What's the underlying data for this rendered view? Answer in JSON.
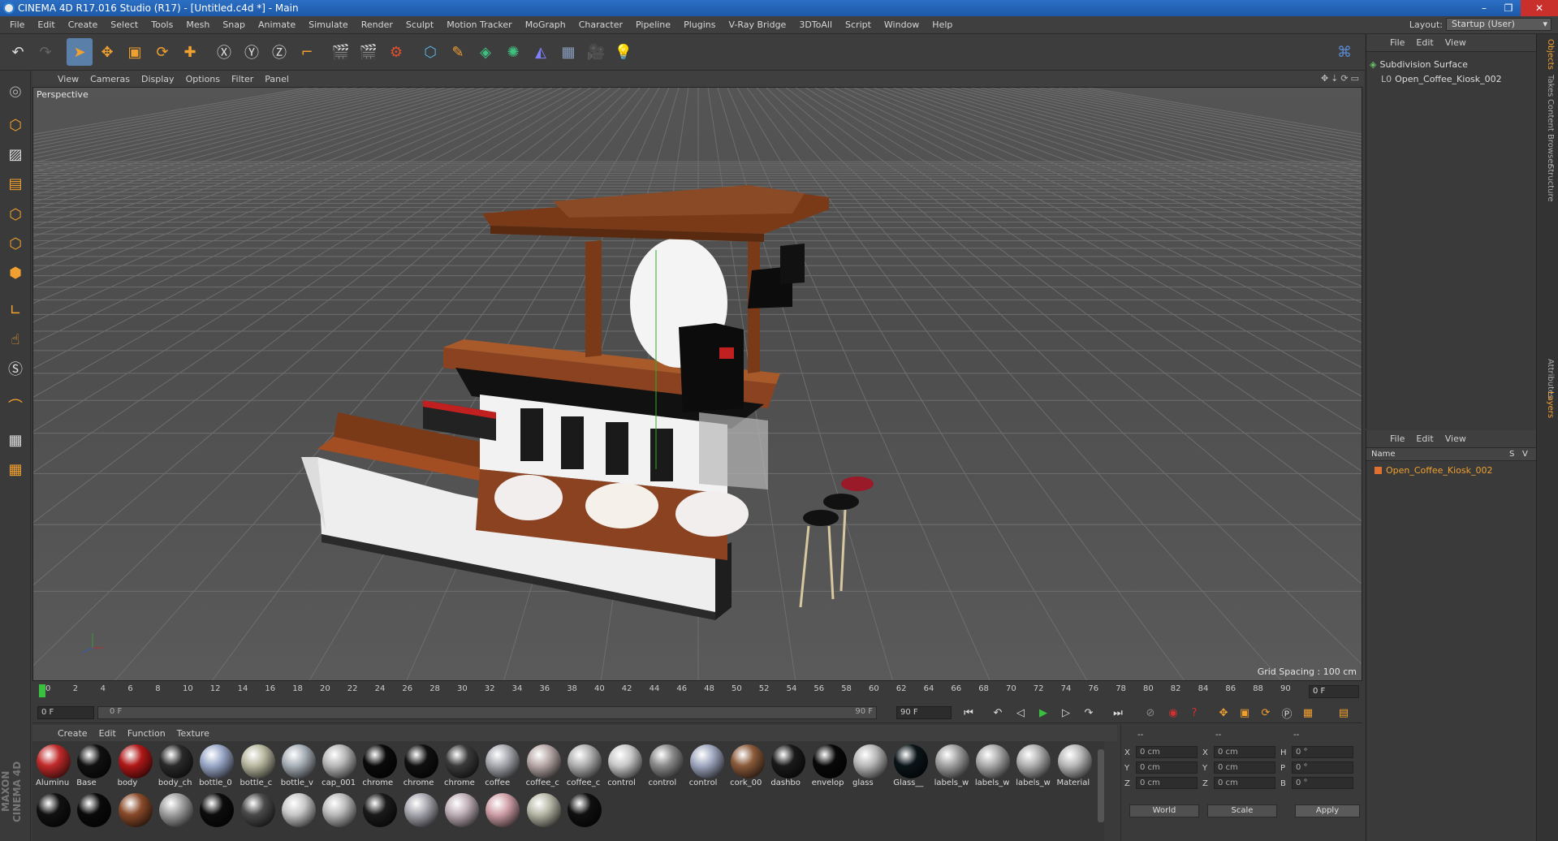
{
  "window": {
    "title": "CINEMA 4D R17.016 Studio (R17) - [Untitled.c4d *] - Main",
    "buttons": [
      "–",
      "❐",
      "✕"
    ]
  },
  "menu": [
    "File",
    "Edit",
    "Create",
    "Select",
    "Tools",
    "Mesh",
    "Snap",
    "Animate",
    "Simulate",
    "Render",
    "Sculpt",
    "Motion Tracker",
    "MoGraph",
    "Character",
    "Pipeline",
    "Plugins",
    "V-Ray Bridge",
    "3DToAll",
    "Script",
    "Window",
    "Help"
  ],
  "layout": {
    "label": "Layout:",
    "value": "Startup (User)"
  },
  "viewport": {
    "menu": [
      "View",
      "Cameras",
      "Display",
      "Options",
      "Filter",
      "Panel"
    ],
    "label": "Perspective",
    "grid_spacing": "Grid Spacing : 100 cm",
    "axis_y": "Y",
    "axis_x": "X"
  },
  "timeline": {
    "ticks": [
      "0",
      "2",
      "4",
      "6",
      "8",
      "10",
      "12",
      "14",
      "16",
      "18",
      "20",
      "22",
      "24",
      "26",
      "28",
      "30",
      "32",
      "34",
      "36",
      "38",
      "40",
      "42",
      "44",
      "46",
      "48",
      "50",
      "52",
      "54",
      "56",
      "58",
      "60",
      "62",
      "64",
      "66",
      "68",
      "70",
      "72",
      "74",
      "76",
      "78",
      "80",
      "82",
      "84",
      "86",
      "88",
      "90"
    ],
    "current": "0 F"
  },
  "playbar": {
    "start": "0 F",
    "slider_start": "0 F",
    "slider_end": "90 F",
    "end": "90 F"
  },
  "material_menu": [
    "Create",
    "Edit",
    "Function",
    "Texture"
  ],
  "materials": [
    {
      "name": "Aluminu",
      "color": "#c02a2a"
    },
    {
      "name": "Base",
      "color": "#111111"
    },
    {
      "name": "body",
      "color": "#b01818"
    },
    {
      "name": "body_ch",
      "color": "#2a2a2a"
    },
    {
      "name": "bottle_0",
      "color": "#9aa8c8"
    },
    {
      "name": "bottle_c",
      "color": "#b8b8a0"
    },
    {
      "name": "bottle_v",
      "color": "#a8b0b8"
    },
    {
      "name": "cap_001",
      "color": "#b8b8b8"
    },
    {
      "name": "chrome",
      "color": "#0a0a0a"
    },
    {
      "name": "chrome",
      "color": "#101010"
    },
    {
      "name": "chrome",
      "color": "#3a3a3a"
    },
    {
      "name": "coffee",
      "color": "#a8aab0"
    },
    {
      "name": "coffee_c",
      "color": "#b8a8a8"
    },
    {
      "name": "coffee_c",
      "color": "#b0b0b0"
    },
    {
      "name": "control",
      "color": "#c8c8c8"
    },
    {
      "name": "control",
      "color": "#8a8a8a"
    },
    {
      "name": "control",
      "color": "#a0a8c0"
    },
    {
      "name": "cork_00",
      "color": "#8a5a3a"
    },
    {
      "name": "dashbo",
      "color": "#1a1a1a"
    },
    {
      "name": "envelop",
      "color": "#080808"
    },
    {
      "name": "glass",
      "color": "#b8b8b8"
    },
    {
      "name": "Glass__",
      "color": "#0a1418"
    },
    {
      "name": "labels_w",
      "color": "#a0a0a0"
    },
    {
      "name": "labels_w",
      "color": "#aaaaaa"
    },
    {
      "name": "labels_w",
      "color": "#b0b0b0"
    },
    {
      "name": "Material",
      "color": "#b8b8b8"
    }
  ],
  "materials_row2": [
    "#111111",
    "#0a0a0a",
    "#8a4a2a",
    "#a0a0a0",
    "#0c0c0c",
    "#4a4a4a",
    "#c8c8c8",
    "#bbbbbb",
    "#1a1a1a",
    "#a8a8b0",
    "#c0b0b8",
    "#d0a0a8",
    "#b8b8a8",
    "#101010"
  ],
  "coords": {
    "headers": [
      "--",
      "--",
      "--"
    ],
    "rows": [
      {
        "a": "X",
        "av": "0 cm",
        "b": "X",
        "bv": "0 cm",
        "c": "H",
        "cv": "0 °"
      },
      {
        "a": "Y",
        "av": "0 cm",
        "b": "Y",
        "bv": "0 cm",
        "c": "P",
        "cv": "0 °"
      },
      {
        "a": "Z",
        "av": "0 cm",
        "b": "Z",
        "bv": "0 cm",
        "c": "B",
        "cv": "0 °"
      }
    ],
    "world": "World",
    "scale": "Scale",
    "apply": "Apply"
  },
  "objects": {
    "menu": [
      "File",
      "Edit",
      "View"
    ],
    "items": [
      "Subdivision Surface",
      "Open_Coffee_Kiosk_002"
    ]
  },
  "layers": {
    "menu": [
      "File",
      "Edit",
      "View"
    ],
    "col_name": "Name",
    "col_s": "S",
    "col_v": "V",
    "items": [
      "Open_Coffee_Kiosk_002"
    ]
  },
  "sidetabs": [
    "Objects",
    "Takes",
    "Content Browser",
    "Structure",
    "Attributes",
    "Layers"
  ],
  "brand": "MAXON CINEMA 4D"
}
